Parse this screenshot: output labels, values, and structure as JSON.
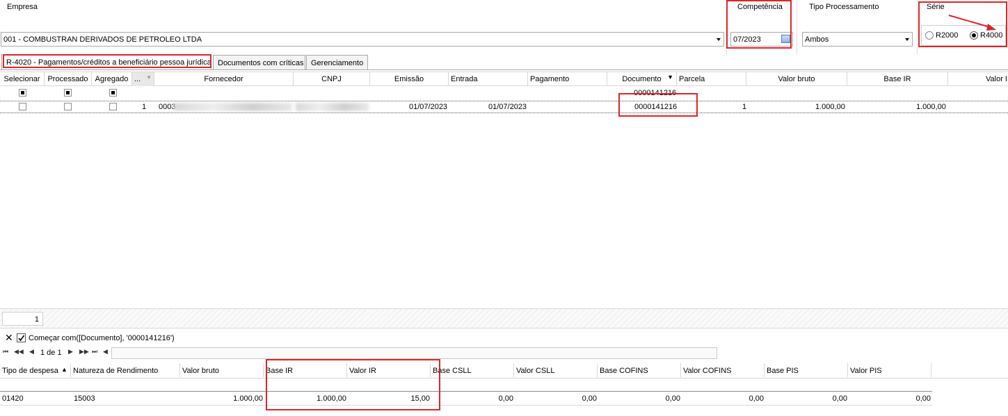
{
  "filters": {
    "empresa_label": "Empresa",
    "empresa_value": "001 - COMBUSTRAN DERIVADOS DE PETROLEO LTDA",
    "competencia_label": "Competência",
    "competencia_value": "07/2023",
    "tipo_label": "Tipo Processamento",
    "tipo_value": "Ambos",
    "serie_label": "Série",
    "serie_options": [
      "R2000",
      "R4000"
    ],
    "serie_selected": "R4000"
  },
  "tabs": [
    {
      "label": "R-4020 - Pagamentos/créditos a beneficiário pessoa jurídica",
      "active": true
    },
    {
      "label": "Documentos com críticas",
      "active": false
    },
    {
      "label": "Gerenciamento",
      "active": false
    }
  ],
  "main_grid": {
    "headers": [
      "Selecionar",
      "Processado",
      "Agregado",
      "...",
      "Fornecedor",
      "CNPJ",
      "Emissão",
      "Entrada",
      "Pagamento",
      "Documento",
      "Parcela",
      "Valor bruto",
      "Base IR",
      "Valor IR"
    ],
    "filter_row": {
      "documento": "0000141216"
    },
    "rows": [
      {
        "index": "1",
        "fornecedor_prefix": "0003",
        "emissao": "01/07/2023",
        "entrada": "01/07/2023",
        "pagamento": "",
        "documento": "0000141216",
        "parcela": "1",
        "valor_bruto": "1.000,00",
        "base_ir": "1.000,00"
      }
    ],
    "footer_count": "1"
  },
  "filter_bar": {
    "text": "Começar com([Documento], '0000141216')",
    "checked": true
  },
  "navigator": {
    "page_text": "1 de 1"
  },
  "detail_grid": {
    "headers": [
      "Tipo de despesa",
      "Natureza de Rendimento",
      "Valor bruto",
      "Base IR",
      "Valor IR",
      "Base CSLL",
      "Valor CSLL",
      "Base COFINS",
      "Valor COFINS",
      "Base PIS",
      "Valor PIS"
    ],
    "rows": [
      [
        "01420",
        "15003",
        "1.000,00",
        "1.000,00",
        "15,00",
        "0,00",
        "0,00",
        "0,00",
        "0,00",
        "0,00",
        "0,00"
      ]
    ]
  },
  "colors": {
    "highlight_red": "#d9262b",
    "border_gray": "#a8a8a8"
  }
}
